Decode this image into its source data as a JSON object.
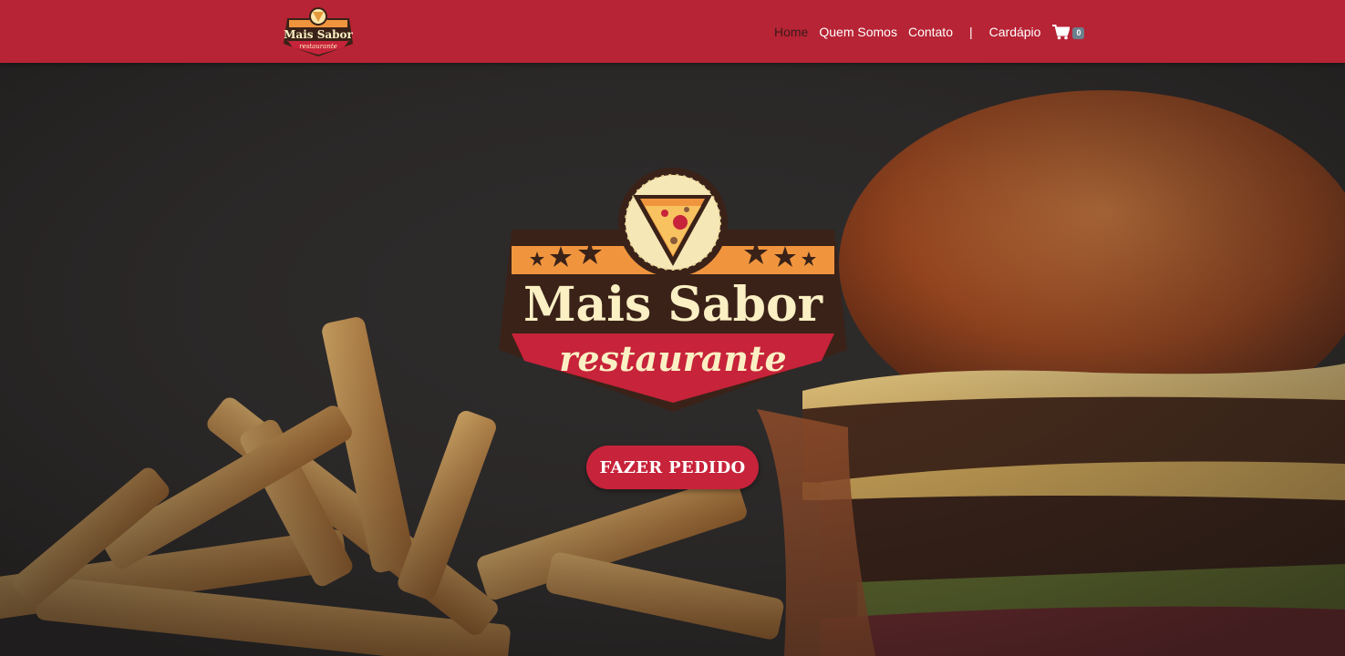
{
  "brand": {
    "name": "Mais Sabor",
    "tagline": "restaurante"
  },
  "nav": {
    "items": [
      {
        "label": "Home",
        "active": true
      },
      {
        "label": "Quem Somos",
        "active": false
      },
      {
        "label": "Contato",
        "active": false
      }
    ],
    "separator": "|",
    "menu_label": "Cardápio",
    "cart_icon": "shopping-cart-icon",
    "cart_count": "0"
  },
  "hero": {
    "cta_label": "FAZER PEDIDO"
  },
  "colors": {
    "navbar": "#b72435",
    "button": "#c7233a",
    "logo_orange": "#f0953e",
    "logo_brown": "#3a2218",
    "logo_cream": "#fbf0c4"
  }
}
